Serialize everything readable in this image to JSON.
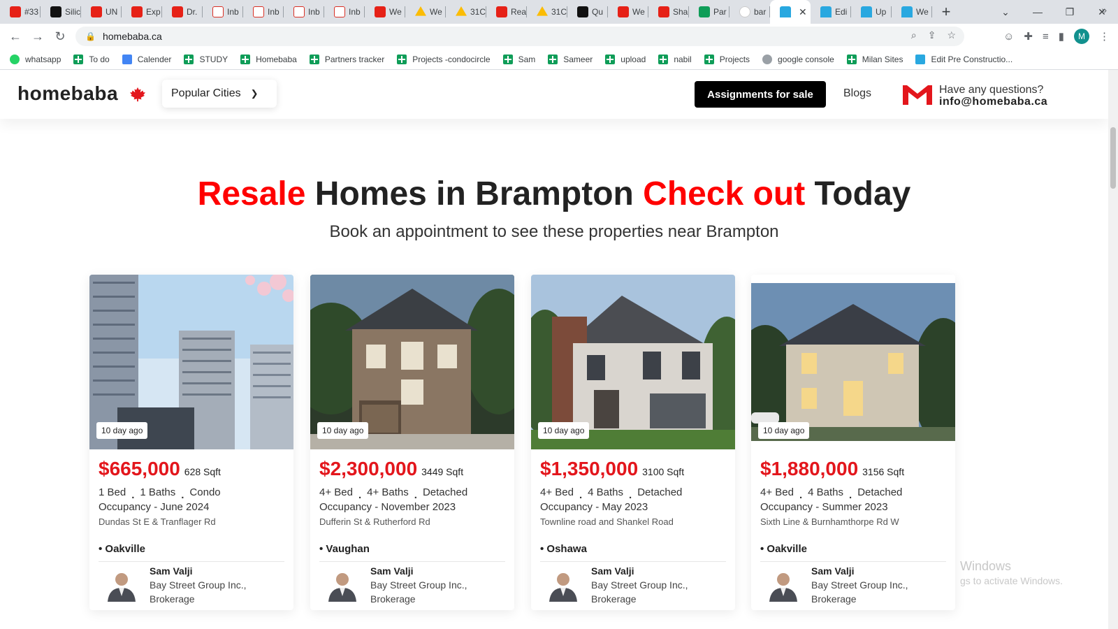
{
  "browser": {
    "tabs": [
      {
        "favicon": "youtube-icon",
        "label": "#33",
        "kind": "yt"
      },
      {
        "favicon": "silicon-icon",
        "label": "Silic",
        "kind": "dk"
      },
      {
        "favicon": "youtube-icon",
        "label": "UN",
        "kind": "yt"
      },
      {
        "favicon": "youtube-icon",
        "label": "Exp",
        "kind": "yt"
      },
      {
        "favicon": "youtube-icon",
        "label": "Dr.",
        "kind": "yt"
      },
      {
        "favicon": "gmail-icon",
        "label": "Inb",
        "kind": "gm"
      },
      {
        "favicon": "gmail-icon",
        "label": "Inb",
        "kind": "gm"
      },
      {
        "favicon": "gmail-icon",
        "label": "Inb",
        "kind": "gm"
      },
      {
        "favicon": "gmail-icon",
        "label": "Inb",
        "kind": "gm"
      },
      {
        "favicon": "youtube-icon",
        "label": "We",
        "kind": "yt"
      },
      {
        "favicon": "drive-icon",
        "label": "We",
        "kind": "dr"
      },
      {
        "favicon": "drive-icon",
        "label": "31C",
        "kind": "dr"
      },
      {
        "favicon": "youtube-icon",
        "label": "Rea",
        "kind": "yt"
      },
      {
        "favicon": "drive-icon",
        "label": "31C",
        "kind": "dr"
      },
      {
        "favicon": "quote-icon",
        "label": "Qu",
        "kind": "dk"
      },
      {
        "favicon": "youtube-icon",
        "label": "We",
        "kind": "yt"
      },
      {
        "favicon": "youtube-icon",
        "label": "Sha",
        "kind": "yt"
      },
      {
        "favicon": "sheets-icon",
        "label": "Par",
        "kind": "sh"
      },
      {
        "favicon": "google-icon",
        "label": "bar",
        "kind": "gg"
      },
      {
        "favicon": "homebaba-icon",
        "label": "",
        "kind": "hb",
        "active": true
      },
      {
        "favicon": "homebaba-icon",
        "label": "Edi",
        "kind": "hb"
      },
      {
        "favicon": "homebaba-icon",
        "label": "Up",
        "kind": "hb"
      },
      {
        "favicon": "homebaba-icon",
        "label": "We",
        "kind": "hb"
      }
    ],
    "url": "homebaba.ca",
    "profile_initial": "M",
    "bookmarks": [
      {
        "label": "whatsapp",
        "icon": "wa"
      },
      {
        "label": "To do",
        "icon": "sheet"
      },
      {
        "label": "Calender",
        "icon": "cal"
      },
      {
        "label": "STUDY",
        "icon": "sheet"
      },
      {
        "label": "Homebaba",
        "icon": "sheet"
      },
      {
        "label": "Partners tracker",
        "icon": "sheet"
      },
      {
        "label": "Projects -condocircle",
        "icon": "sheet"
      },
      {
        "label": "Sam",
        "icon": "sheet"
      },
      {
        "label": "Sameer",
        "icon": "sheet"
      },
      {
        "label": "upload",
        "icon": "sheet"
      },
      {
        "label": "nabil",
        "icon": "sheet"
      },
      {
        "label": "Projects",
        "icon": "sheet"
      },
      {
        "label": "google console",
        "icon": "gc"
      },
      {
        "label": "Milan Sites",
        "icon": "sheet"
      },
      {
        "label": "Edit Pre Constructio...",
        "icon": "hb"
      }
    ]
  },
  "site": {
    "logo": "homebaba",
    "popular_cities": "Popular Cities",
    "assignments_button": "Assignments for sale",
    "blogs": "Blogs",
    "contact_question": "Have any questions?",
    "contact_email": "info@homebaba.ca",
    "accent_color": "#ff0000"
  },
  "hero": {
    "w1": "Resale",
    "w2": " Homes in Brampton ",
    "w3": "Check out",
    "w4": " Today",
    "subtitle": "Book an appointment to see these properties near Brampton"
  },
  "listings": [
    {
      "badge": "10 day ago",
      "price": "$665,000",
      "sqft": "628 Sqft",
      "bed": "1 Bed",
      "bath": "1 Baths",
      "type": "Condo",
      "occupancy": "Occupancy - June 2024",
      "address": "Dundas St E & Tranflager Rd",
      "city": "Oakville",
      "agent_name": "Sam Valji",
      "agent_company": "Bay Street Group Inc., Brokerage"
    },
    {
      "badge": "10 day ago",
      "price": "$2,300,000",
      "sqft": "3449 Sqft",
      "bed": "4+ Bed",
      "bath": "4+ Baths",
      "type": "Detached",
      "occupancy": "Occupancy - November 2023",
      "address": "Dufferin St & Rutherford Rd",
      "city": "Vaughan",
      "agent_name": "Sam Valji",
      "agent_company": "Bay Street Group Inc., Brokerage"
    },
    {
      "badge": "10 day ago",
      "price": "$1,350,000",
      "sqft": "3100 Sqft",
      "bed": "4+ Bed",
      "bath": "4 Baths",
      "type": "Detached",
      "occupancy": "Occupancy - May 2023",
      "address": "Townline road and Shankel Road",
      "city": "Oshawa",
      "agent_name": "Sam Valji",
      "agent_company": "Bay Street Group Inc., Brokerage"
    },
    {
      "badge": "10 day ago",
      "price": "$1,880,000",
      "sqft": "3156 Sqft",
      "bed": "4+ Bed",
      "bath": "4 Baths",
      "type": "Detached",
      "occupancy": "Occupancy - Summer 2023",
      "address": "Sixth Line & Burnhamthorpe Rd W",
      "city": "Oakville",
      "agent_name": "Sam Valji",
      "agent_company": "Bay Street Group Inc., Brokerage"
    }
  ],
  "os_watermark": {
    "line1": "Windows",
    "line2": "gs to activate Windows."
  }
}
